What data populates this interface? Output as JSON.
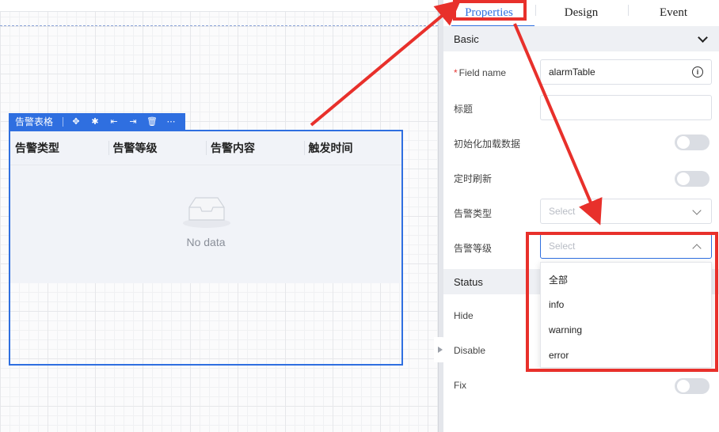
{
  "canvas": {
    "component": {
      "toolbar_title": "告警表格",
      "toolbar_icons": [
        "move-icon",
        "bug-icon",
        "align-left-icon",
        "align-right-icon",
        "delete-icon",
        "more-icon"
      ],
      "toolbar_glyphs": [
        "✥",
        "✱",
        "⇤",
        "⇥",
        "🗑",
        "⋯"
      ]
    },
    "table": {
      "columns": [
        "告警类型",
        "告警等级",
        "告警内容",
        "触发时间"
      ],
      "empty_text": "No data"
    }
  },
  "panel": {
    "tabs": [
      {
        "label": "Properties",
        "active": true
      },
      {
        "label": "Design",
        "active": false
      },
      {
        "label": "Event",
        "active": false
      }
    ],
    "basic": {
      "header": "Basic",
      "field_name_label": "Field name",
      "field_name_value": "alarmTable",
      "title_label": "标题",
      "title_value": "",
      "init_load_label": "初始化加载数据",
      "init_load_on": false,
      "timed_refresh_label": "定时刷新",
      "timed_refresh_on": false,
      "alarm_type_label": "告警类型",
      "alarm_type_placeholder": "Select",
      "alarm_level_label": "告警等级",
      "alarm_level_placeholder": "Select"
    },
    "alarm_level_options": [
      "全部",
      "info",
      "warning",
      "error"
    ],
    "status": {
      "header": "Status",
      "hide_label": "Hide",
      "disable_label": "Disable",
      "fix_label": "Fix",
      "fix_on": false
    }
  },
  "colors": {
    "accent": "#2f6fe0",
    "annotation": "#e8302b"
  }
}
